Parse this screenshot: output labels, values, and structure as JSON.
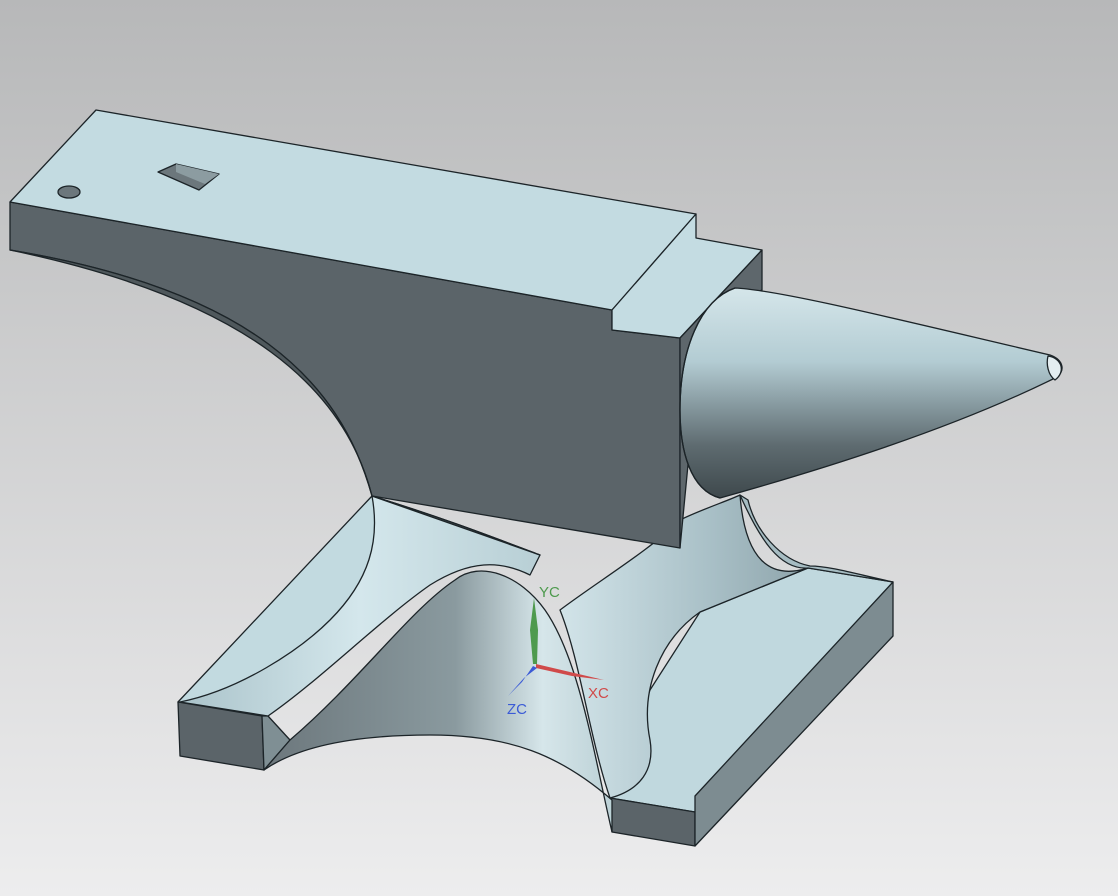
{
  "viewport": {
    "background_top": "#b7b8b9",
    "background_bottom": "#ededee"
  },
  "model": {
    "face_light": "#c3dbe1",
    "face_dark": "#5b6469",
    "edge_color": "#1c2428"
  },
  "triad": {
    "y_label": "YC",
    "x_label": "XC",
    "z_label": "ZC",
    "y_color": "#4e9a4e",
    "x_color": "#d04a4a",
    "z_color": "#3b5bd6"
  }
}
